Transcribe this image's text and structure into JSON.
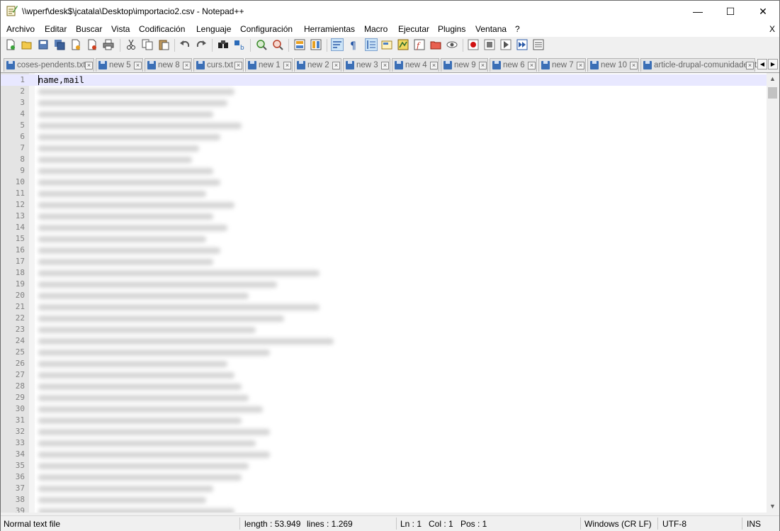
{
  "window": {
    "title": "\\\\wperf\\desk$\\jcatala\\Desktop\\importacio2.csv - Notepad++",
    "minimize": "—",
    "maximize": "☐",
    "close": "✕"
  },
  "menu": {
    "items": [
      {
        "label": "Archivo"
      },
      {
        "label": "Editar"
      },
      {
        "label": "Buscar"
      },
      {
        "label": "Vista"
      },
      {
        "label": "Codificación"
      },
      {
        "label": "Lenguaje"
      },
      {
        "label": "Configuración"
      },
      {
        "label": "Herramientas"
      },
      {
        "label": "Macro"
      },
      {
        "label": "Ejecutar"
      },
      {
        "label": "Plugins"
      },
      {
        "label": "Ventana"
      },
      {
        "label": "?"
      }
    ],
    "close_doc": "X"
  },
  "toolbar": {
    "icons": [
      "new-file-icon",
      "open-file-icon",
      "save-icon",
      "save-all-icon",
      "close-icon",
      "close-all-icon",
      "print-icon",
      "cut-icon",
      "copy-icon",
      "paste-icon",
      "undo-icon",
      "redo-icon",
      "find-icon",
      "replace-icon",
      "zoom-in-icon",
      "zoom-out-icon",
      "sync-vertical-icon",
      "sync-horizontal-icon",
      "word-wrap-icon",
      "show-all-chars-icon",
      "indent-guide-icon",
      "user-language-icon",
      "document-map-icon",
      "function-list-icon",
      "folder-workspace-icon",
      "monitoring-icon",
      "record-macro-icon",
      "stop-record-icon",
      "play-macro-icon",
      "run-macro-multiple-icon",
      "save-macro-icon"
    ]
  },
  "tabs": [
    {
      "label": "coses-pendents.txt",
      "active": false
    },
    {
      "label": "new 5",
      "active": false
    },
    {
      "label": "new 8",
      "active": false
    },
    {
      "label": "curs.txt",
      "active": false
    },
    {
      "label": "new 1",
      "active": false
    },
    {
      "label": "new 2",
      "active": false
    },
    {
      "label": "new 3",
      "active": false
    },
    {
      "label": "new 4",
      "active": false
    },
    {
      "label": "new 9",
      "active": false
    },
    {
      "label": "new 6",
      "active": false
    },
    {
      "label": "new 7",
      "active": false
    },
    {
      "label": "new 10",
      "active": false
    },
    {
      "label": "article-drupal-comunidades.txt",
      "active": false
    }
  ],
  "editor": {
    "first_line": "name,mail",
    "line_numbers": [
      "1",
      "2",
      "3",
      "4",
      "5",
      "6",
      "7",
      "8",
      "9",
      "10",
      "11",
      "12",
      "13",
      "14",
      "15",
      "16",
      "17",
      "18",
      "19",
      "20",
      "21",
      "22",
      "23",
      "24",
      "25",
      "26",
      "27",
      "28",
      "29",
      "30",
      "31",
      "32",
      "33",
      "34",
      "35",
      "36",
      "37",
      "38",
      "39"
    ]
  },
  "status": {
    "file_type": "Normal text file",
    "length": "length : 53.949",
    "lines": "lines : 1.269",
    "ln": "Ln : 1",
    "col": "Col : 1",
    "pos": "Pos : 1",
    "eol": "Windows (CR LF)",
    "encoding": "UTF-8",
    "mode": "INS"
  }
}
